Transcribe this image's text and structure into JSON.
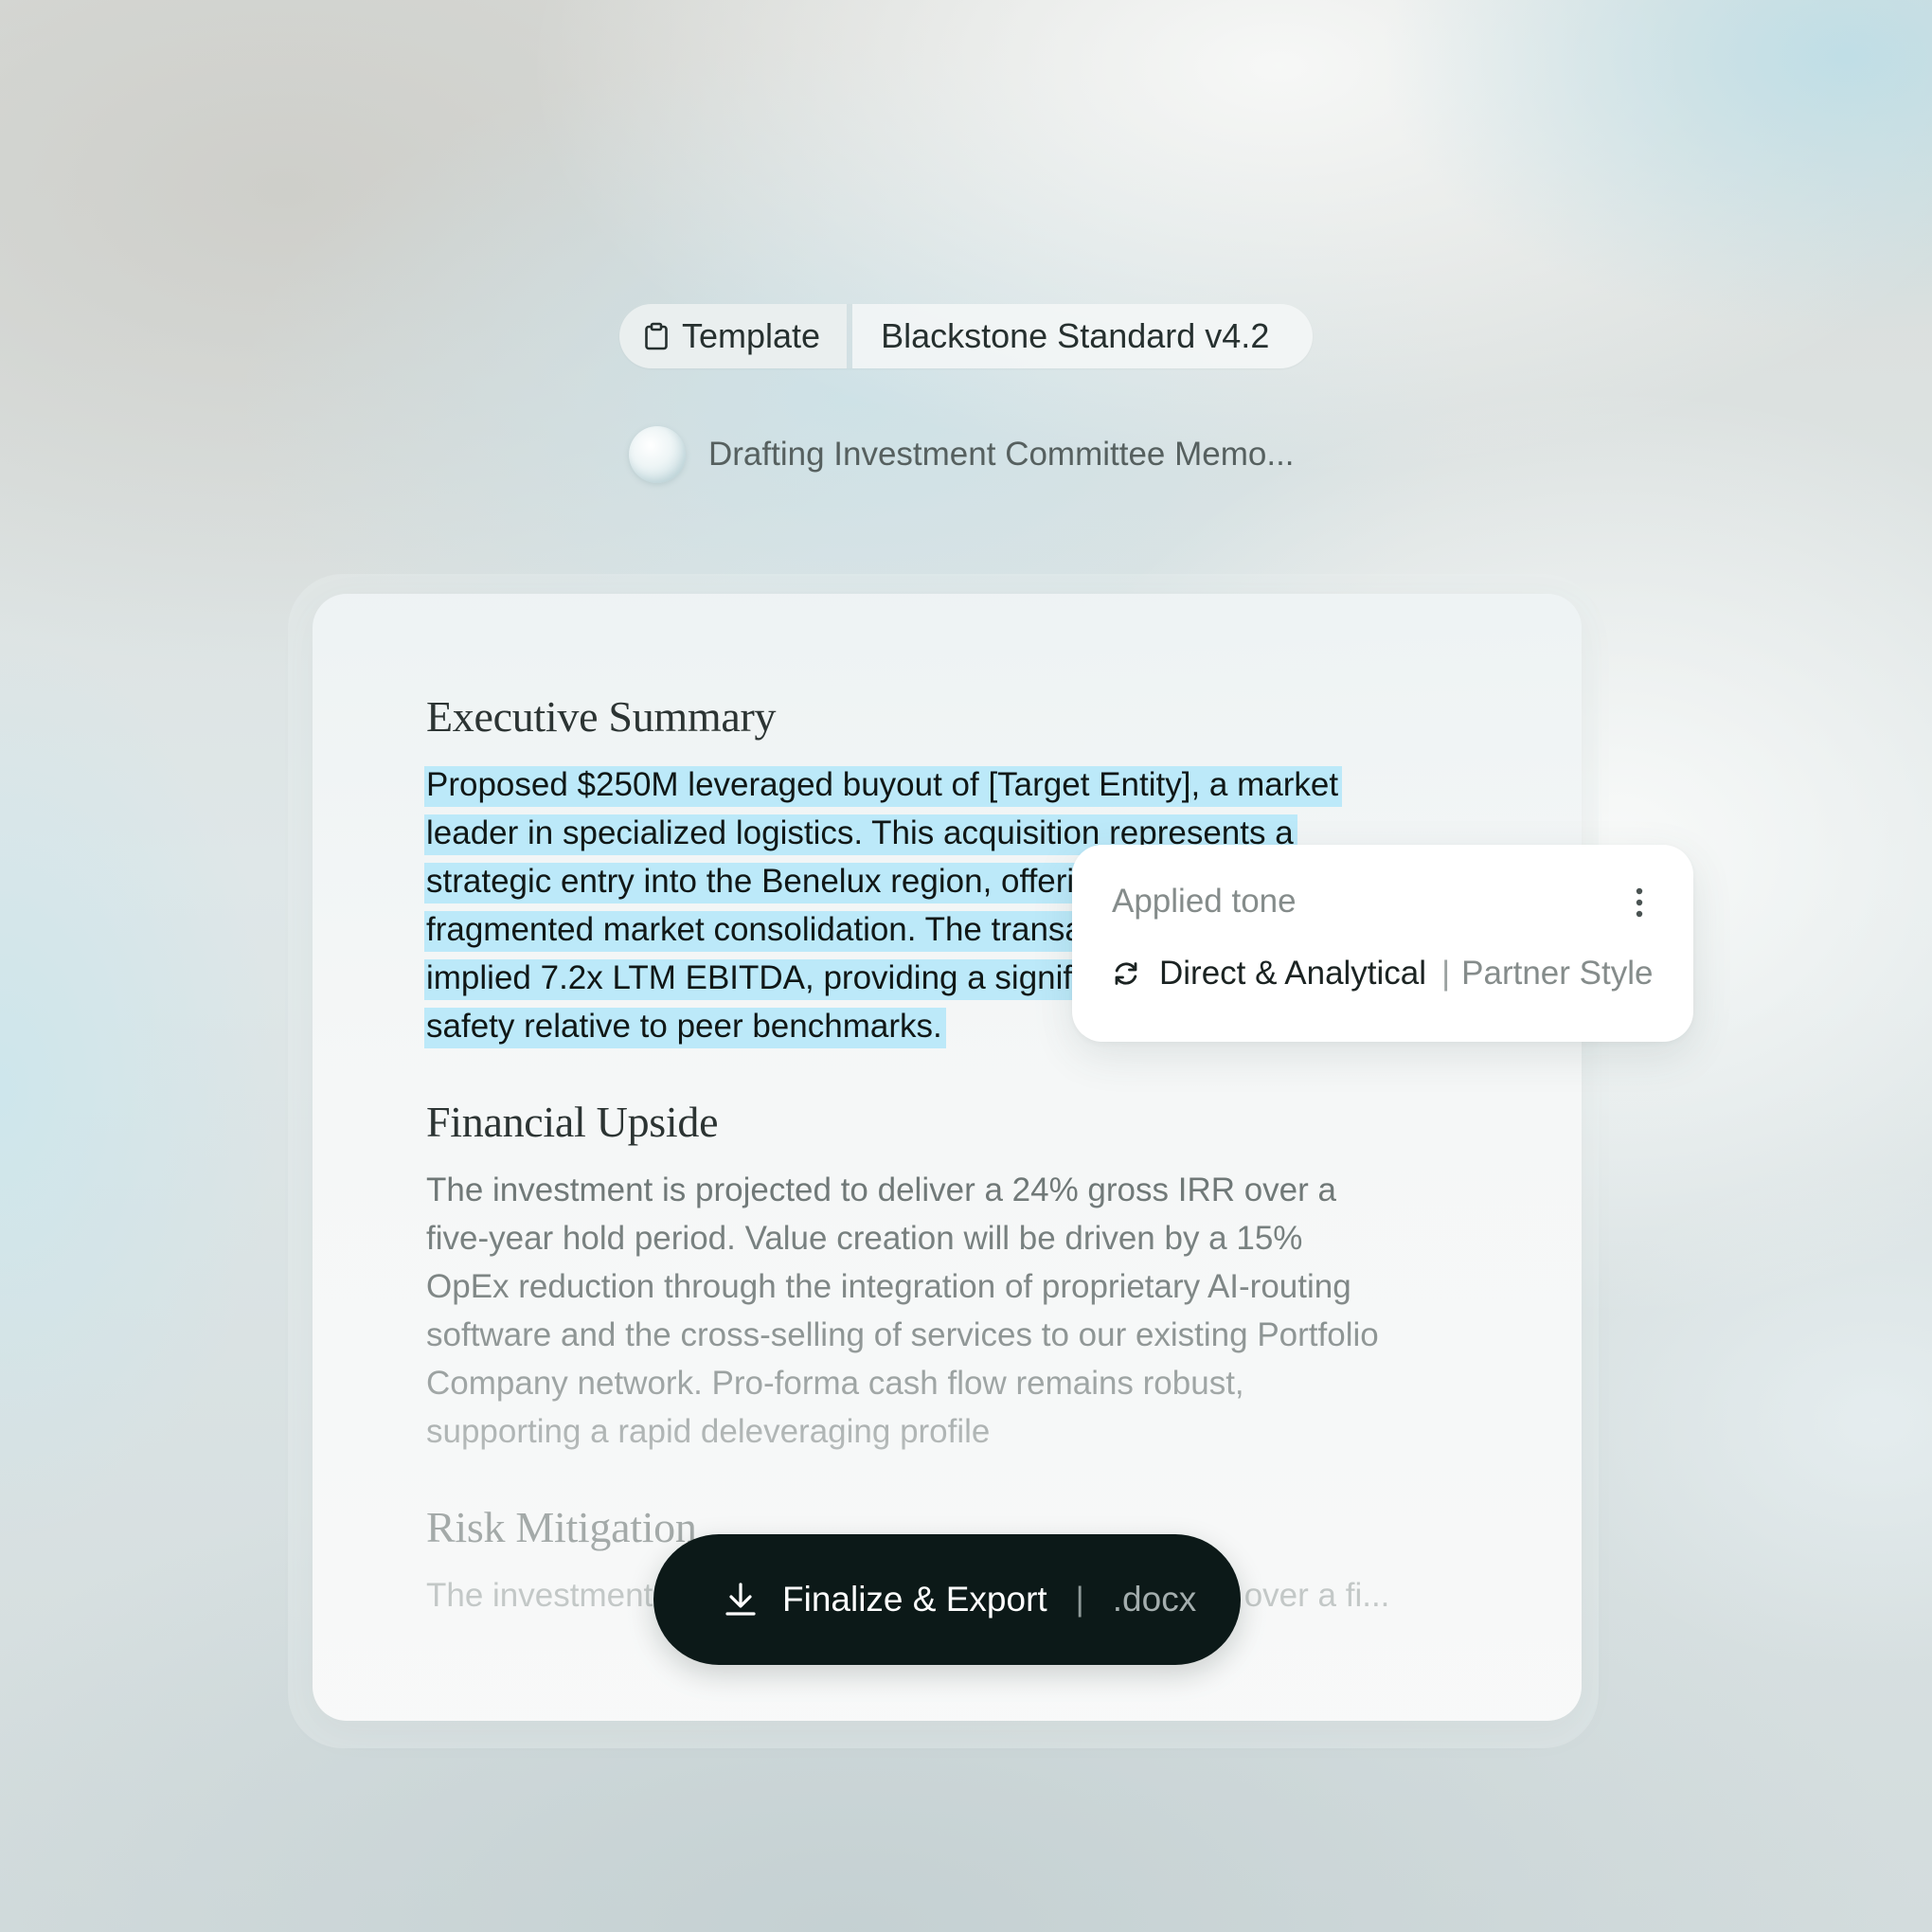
{
  "template_pill": {
    "label": "Template",
    "value": "Blackstone Standard v4.2"
  },
  "status": {
    "text": "Drafting Investment Committee Memo..."
  },
  "document": {
    "sections": [
      {
        "heading": "Executive Summary",
        "body": "Proposed $250M leveraged buyout of [Target Entity], a market leader in specialized logistics. This acquisition represents a strategic entry into the Benelux region, offering a platform for fragmented market consolidation. The transaction is priced at an implied 7.2x LTM EBITDA, providing a significant margin of safety relative to peer benchmarks.",
        "highlighted": true
      },
      {
        "heading": "Financial Upside",
        "body": "The investment is projected to deliver a 24% gross IRR over a five-year hold period. Value creation will be driven by a 15% OpEx reduction through the integration of proprietary AI-routing software and the cross-selling of services to our existing Portfolio Company network. Pro-forma cash flow remains robust, supporting a rapid deleveraging profile"
      },
      {
        "heading": "Risk Mitigation",
        "body": "The investment is projected to deliver a 24% gross IRR over a fi..."
      }
    ]
  },
  "tone_popover": {
    "label": "Applied tone",
    "tone": "Direct & Analytical",
    "separator": "|",
    "style": "Partner Style",
    "menu_icon": "more-vertical-icon",
    "tone_icon": "refresh-icon"
  },
  "export_button": {
    "label": "Finalize & Export",
    "separator": "|",
    "format": ".docx",
    "icon": "download-icon"
  },
  "colors": {
    "highlight": "#bce9f9",
    "button_bg": "#0c1918",
    "card_bg": "#f5f7f7"
  }
}
